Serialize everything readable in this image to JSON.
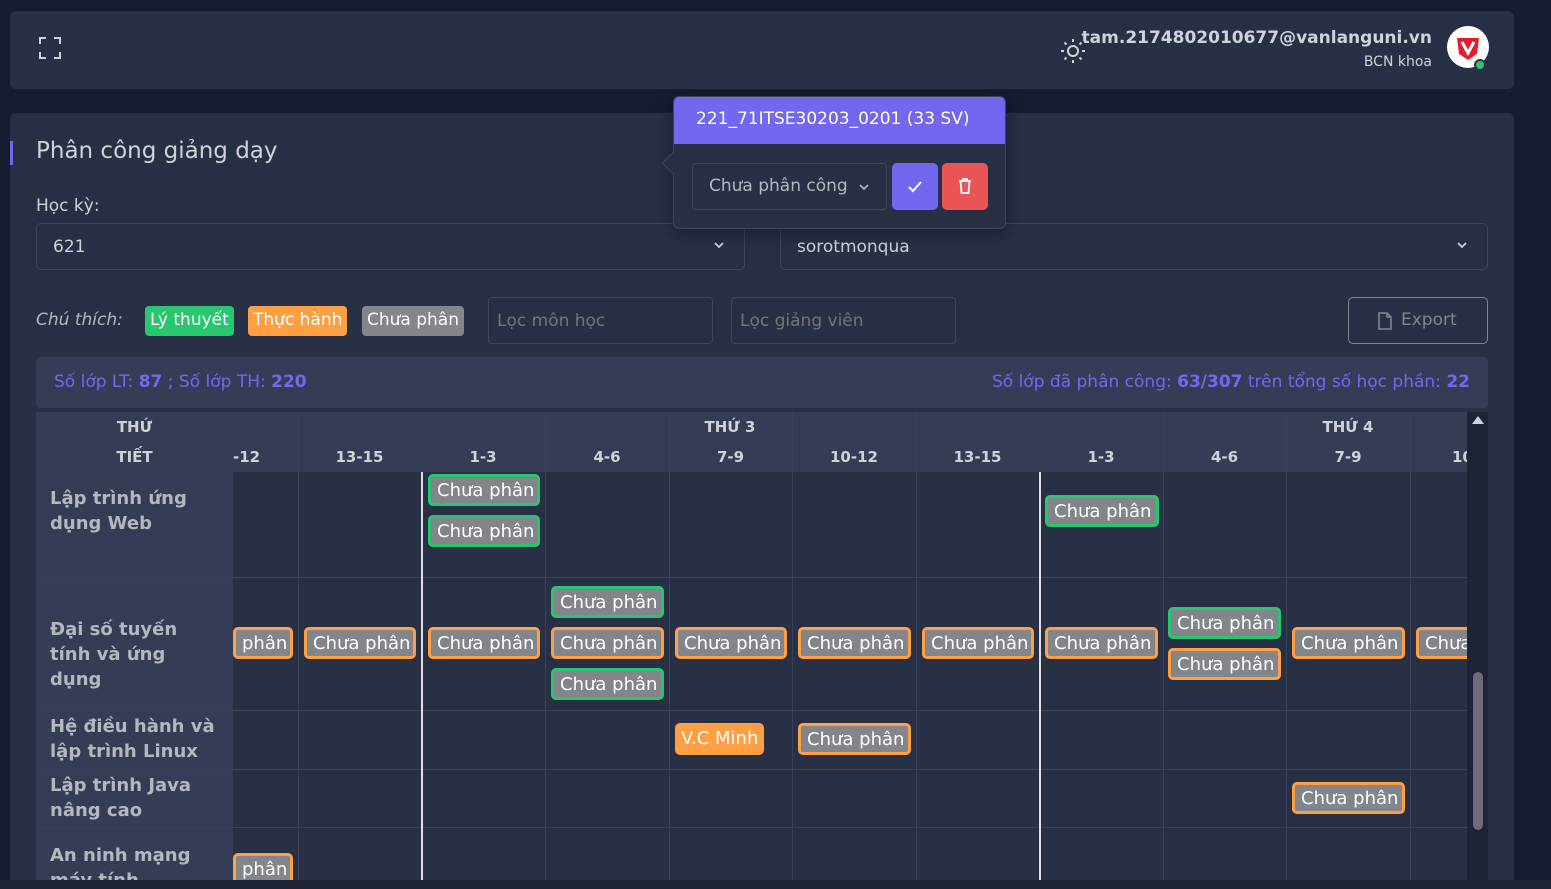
{
  "header": {
    "user_email": "tam.2174802010677@vanlanguni.vn",
    "user_role": "BCN khoa"
  },
  "page": {
    "title": "Phân công giảng dạy",
    "semester_label": "Học kỳ:",
    "semester_value": "621",
    "department_value": "sorotmonqua"
  },
  "legend": {
    "label": "Chú thích:",
    "items": [
      {
        "label": "Lý thuyết",
        "color": "#28c76f"
      },
      {
        "label": "Thực hành",
        "color": "#ff9f43"
      },
      {
        "label": "Chưa phân",
        "color": "#82868b"
      }
    ]
  },
  "filters": {
    "subject_placeholder": "Lọc môn học",
    "lecturer_placeholder": "Lọc giảng viên",
    "export_label": "Export"
  },
  "stats": {
    "lt_label": "Số lớp LT:",
    "lt_value": "87",
    "th_label": "; Số lớp TH:",
    "th_value": "220",
    "assigned_label": "Số lớp đã phân công:",
    "assigned_value": "63/307",
    "total_label": "trên tổng số học phần:",
    "total_value": "22"
  },
  "schedule": {
    "day_header_label": "THỨ",
    "period_header_label": "TIẾT",
    "days": [
      "THỨ 3",
      "THỨ 4"
    ],
    "periods": [
      "-12",
      "13-15",
      "1-3",
      "4-6",
      "7-9",
      "10-12",
      "13-15",
      "1-3",
      "4-6",
      "7-9",
      "10"
    ],
    "subjects": [
      "Lập trình ứng dụng Web",
      "Đại số tuyến tính và ứng dụng",
      "Hệ điều hành và lập trình Linux",
      "Lập trình Java nâng cao",
      "An ninh mạng máy tính"
    ],
    "chip_default": "Chưa phân",
    "chip_partial_left": "phân",
    "chip_partial_right": "Chưa",
    "assigned_chip": "V.C Minh"
  },
  "popover": {
    "title": "221_71ITSE30203_0201 (33 SV)",
    "select_value": "Chưa phân công"
  },
  "colors": {
    "accent": "#7367f0",
    "theory": "#28c76f",
    "practice": "#ff9f43",
    "unassigned": "#82868b",
    "danger": "#ea5455"
  }
}
